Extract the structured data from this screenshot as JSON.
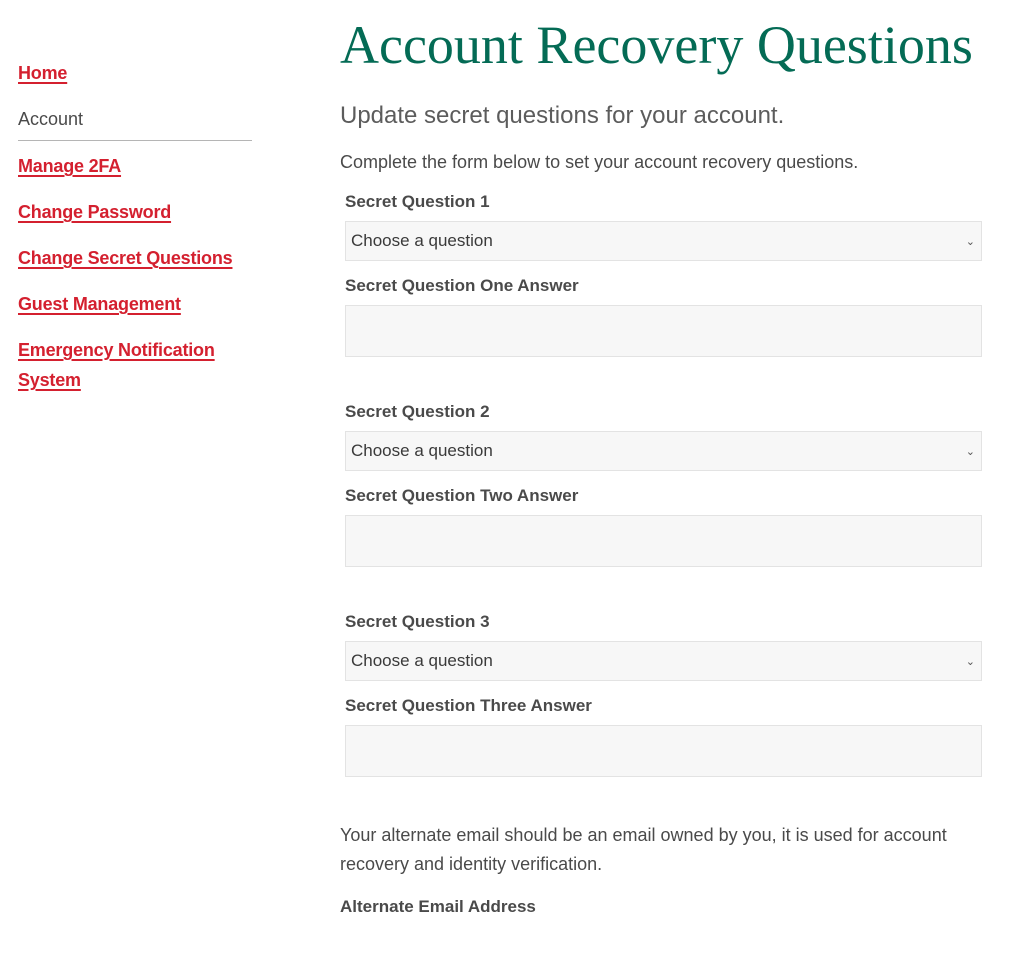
{
  "sidebar": {
    "items": [
      {
        "label": "Home",
        "type": "link"
      },
      {
        "label": "Account",
        "type": "current"
      },
      {
        "label": "Manage 2FA",
        "type": "link"
      },
      {
        "label": "Change Password",
        "type": "link"
      },
      {
        "label": "Change Secret Questions",
        "type": "link"
      },
      {
        "label": "Guest Management",
        "type": "link"
      },
      {
        "label": "Emergency Notification System",
        "type": "link"
      }
    ]
  },
  "main": {
    "title": "Account Recovery Questions",
    "subtitle": "Update secret questions for your account.",
    "intro": "Complete the form below to set your account recovery questions.",
    "questions": [
      {
        "label": "Secret Question 1",
        "select_value": "Choose a question",
        "answer_label": "Secret Question One Answer",
        "answer_value": ""
      },
      {
        "label": "Secret Question 2",
        "select_value": "Choose a question",
        "answer_label": "Secret Question Two Answer",
        "answer_value": ""
      },
      {
        "label": "Secret Question 3",
        "select_value": "Choose a question",
        "answer_label": "Secret Question Three Answer",
        "answer_value": ""
      }
    ],
    "alternate_email_text": "Your alternate email should be an email owned by you, it is used for account recovery and identity verification.",
    "alternate_email_label": "Alternate Email Address"
  },
  "colors": {
    "link": "#d4202f",
    "title": "#046b55",
    "text": "#4a4a4a",
    "field_bg": "#f7f7f7"
  }
}
